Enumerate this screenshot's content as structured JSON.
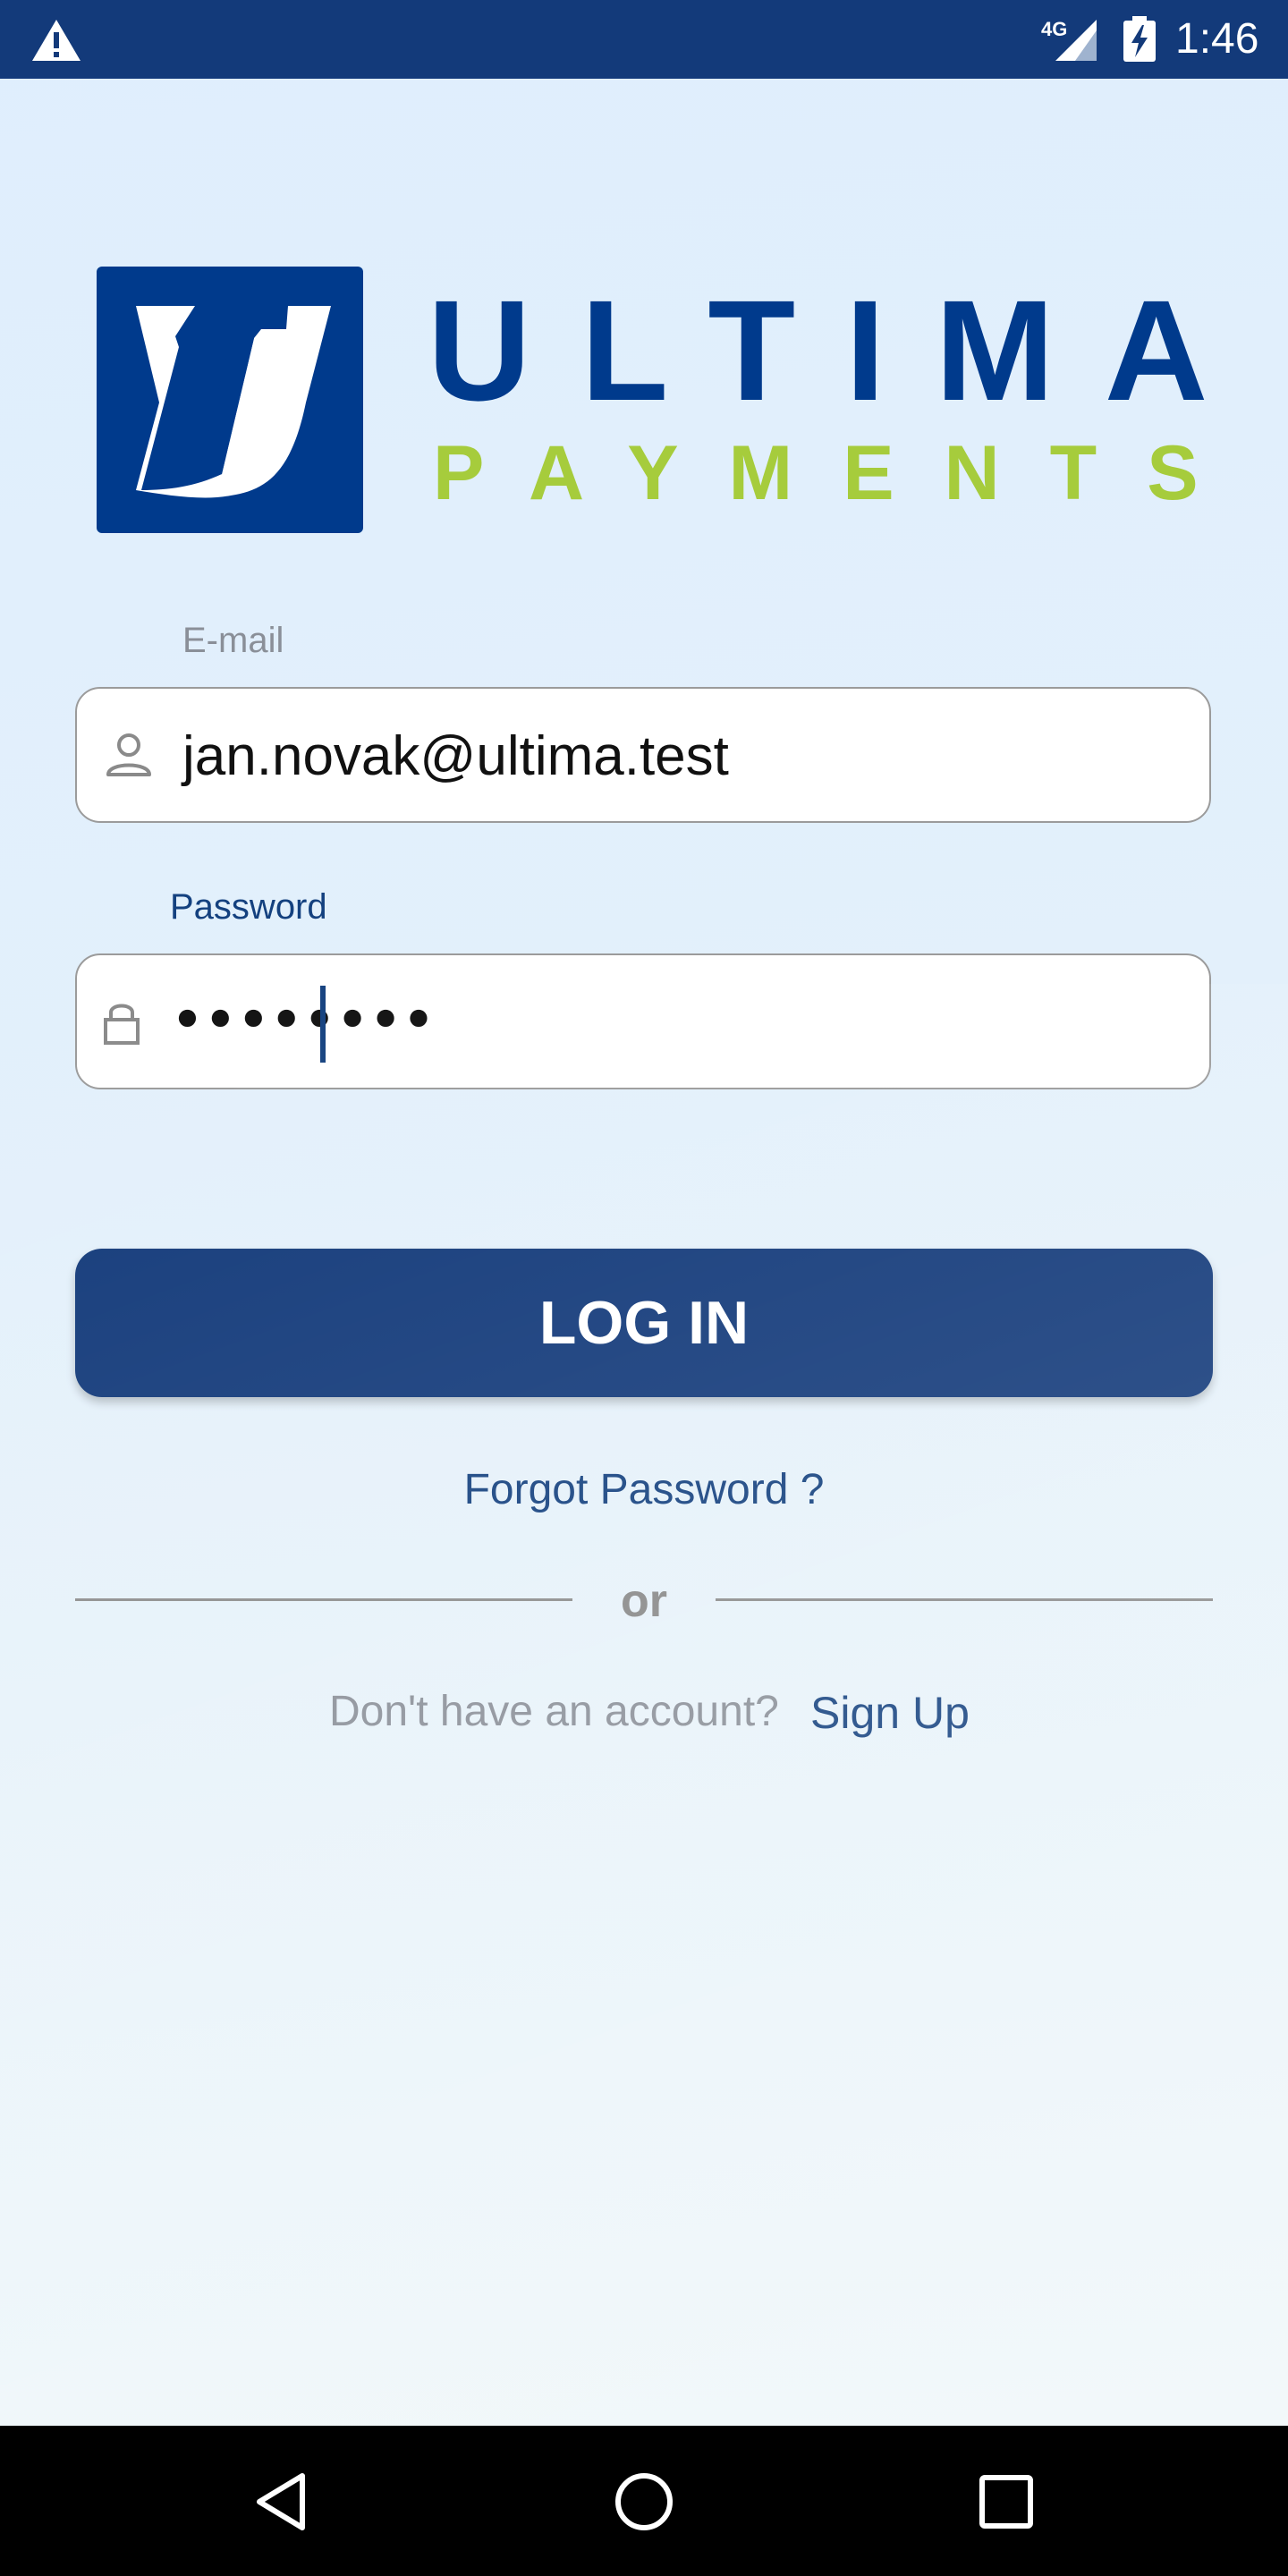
{
  "status_bar": {
    "network": "4G",
    "time": "1:46",
    "icons": [
      "warning-icon",
      "signal-icon",
      "battery-charging-icon"
    ]
  },
  "logo": {
    "word": "ULTIMA",
    "sub": "PAYMENTS",
    "colors": {
      "primary": "#003a8c",
      "accent": "#a6cc3c"
    }
  },
  "email": {
    "label": "E-mail",
    "value": "jan.novak@ultima.test",
    "icon": "person-icon"
  },
  "password": {
    "label": "Password",
    "value": "••••••••",
    "icon": "lock-icon"
  },
  "login_button": {
    "label": "LOG IN"
  },
  "forgot_link": "Forgot Password ?",
  "separator": "or",
  "signup": {
    "prompt": "Don't have an account?",
    "link": "Sign Up"
  },
  "nav": [
    "back-icon",
    "home-icon",
    "recents-icon"
  ],
  "colors": {
    "brand": "#133a7a",
    "link": "#14417f",
    "muted": "#8a8f98"
  }
}
